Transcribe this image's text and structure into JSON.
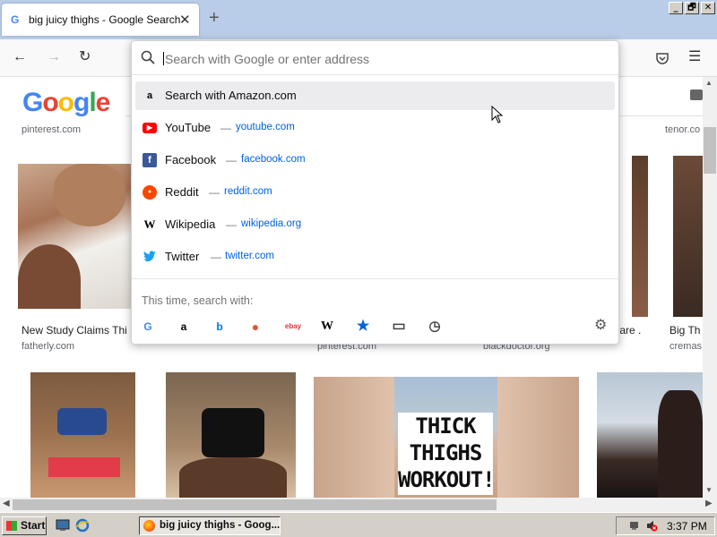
{
  "browser": {
    "tab": {
      "title": "big juicy thighs - Google Search",
      "favicon": "google-g-icon",
      "close": "✕"
    },
    "new_tab": "+",
    "window_buttons": [
      "_",
      "🗗",
      "✕"
    ],
    "nav": {
      "back": "←",
      "forward": "→",
      "reload": "↻",
      "pocket": "pocket-icon",
      "menu": "☰"
    }
  },
  "urlbar": {
    "placeholder": "Search with Google or enter address",
    "value": "",
    "suggestions": [
      {
        "icon": "amazon-icon",
        "glyph": "a",
        "title": "Search with Amazon.com",
        "url": "",
        "highlighted": true
      },
      {
        "icon": "youtube-icon",
        "glyph": "▶",
        "title": "YouTube",
        "url": "youtube.com"
      },
      {
        "icon": "facebook-icon",
        "glyph": "f",
        "title": "Facebook",
        "url": "facebook.com"
      },
      {
        "icon": "reddit-icon",
        "glyph": "●",
        "title": "Reddit",
        "url": "reddit.com"
      },
      {
        "icon": "wikipedia-icon",
        "glyph": "W",
        "title": "Wikipedia",
        "url": "wikipedia.org"
      },
      {
        "icon": "twitter-icon",
        "glyph": "🐦",
        "title": "Twitter",
        "url": "twitter.com"
      }
    ],
    "separator": "—",
    "this_time_label": "This time, search with:",
    "engines": [
      {
        "name": "google-engine-icon",
        "glyph": "G",
        "color": "#4285f4"
      },
      {
        "name": "amazon-engine-icon",
        "glyph": "a",
        "color": "#000000"
      },
      {
        "name": "bing-engine-icon",
        "glyph": "b",
        "color": "#0078d7"
      },
      {
        "name": "duckduckgo-engine-icon",
        "glyph": "●",
        "color": "#de5833"
      },
      {
        "name": "ebay-engine-icon",
        "glyph": "ebay",
        "color": "#e53238"
      },
      {
        "name": "wikipedia-engine-icon",
        "glyph": "W",
        "color": "#000000"
      },
      {
        "name": "bookmarks-icon",
        "glyph": "★",
        "color": "#0060df"
      },
      {
        "name": "tabs-icon",
        "glyph": "▭",
        "color": "#444444"
      },
      {
        "name": "history-icon",
        "glyph": "◷",
        "color": "#444444"
      }
    ],
    "settings_icon": "⚙"
  },
  "page": {
    "logo": "Google",
    "top_sources": [
      "pinterest.com",
      "tenor.co"
    ],
    "row1": [
      {
        "caption": "New Study Claims Thi",
        "source": "fatherly.com"
      },
      {
        "caption": "",
        "source": "pinterest.com"
      },
      {
        "caption": "trare ...",
        "source": "blackdoctor.org"
      },
      {
        "caption": "Big Th",
        "source": "cremas"
      }
    ],
    "thick_text": "THICK THIGHS WORKOUT!"
  },
  "taskbar": {
    "start_label": "Start",
    "task_title": "big juicy thighs - Goog...",
    "clock": "3:37 PM"
  },
  "colors": {
    "accent": "#0060df",
    "tab_strip": "#b9cde8",
    "taskbar": "#d4d0c8"
  }
}
